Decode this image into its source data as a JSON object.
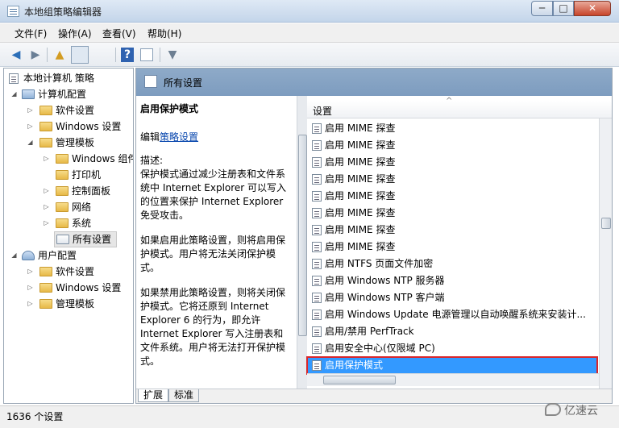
{
  "window": {
    "title": "本地组策略编辑器",
    "min_glyph": "─",
    "max_glyph": "□",
    "close_glyph": "✕"
  },
  "menu": [
    {
      "label": "文件(F)"
    },
    {
      "label": "操作(A)"
    },
    {
      "label": "查看(V)"
    },
    {
      "label": "帮助(H)"
    }
  ],
  "toolbar": {
    "back_glyph": "◀",
    "forward_glyph": "▶",
    "up_glyph": "▲",
    "help_glyph": "?",
    "filter_glyph": "▼"
  },
  "tree": {
    "root": "本地计算机 策略",
    "computer_config": "计算机配置",
    "software_settings": "软件设置",
    "windows_settings": "Windows 设置",
    "admin_templates": "管理模板",
    "windows_components": "Windows 组件",
    "printers": "打印机",
    "control_panel": "控制面板",
    "network": "网络",
    "system": "系统",
    "all_settings": "所有设置",
    "user_config": "用户配置",
    "u_software_settings": "软件设置",
    "u_windows_settings": "Windows 设置",
    "u_admin_templates": "管理模板"
  },
  "right_header": {
    "title": "所有设置"
  },
  "description": {
    "policy_title": "启用保护模式",
    "edit_prefix": "编辑",
    "edit_link": "策略设置",
    "desc_label": "描述:",
    "p1": "保护模式通过减少注册表和文件系统中 Internet Explorer 可以写入的位置来保护 Internet Explorer 免受攻击。",
    "p2": "如果启用此策略设置，则将启用保护模式。用户将无法关闭保护模式。",
    "p3": "如果禁用此策略设置，则将关闭保护模式。它将还原到 Internet Explorer 6 的行为，即允许 Internet Explorer 写入注册表和文件系统。用户将无法打开保护模式。"
  },
  "list": {
    "column": "设置",
    "sort_glyph": "^",
    "rows": [
      "启用 MIME 探查",
      "启用 MIME 探查",
      "启用 MIME 探查",
      "启用 MIME 探查",
      "启用 MIME 探查",
      "启用 MIME 探查",
      "启用 MIME 探查",
      "启用 MIME 探查",
      "启用 NTFS 页面文件加密",
      "启用 Windows NTP 服务器",
      "启用 Windows NTP 客户端",
      "启用 Windows Update 电源管理以自动唤醒系统来安装计...",
      "启用/禁用 PerfTrack",
      "启用安全中心(仅限域 PC)",
      "启用保护模式"
    ],
    "selected_index": 14
  },
  "tabs": {
    "extended": "扩展",
    "standard": "标准"
  },
  "status": {
    "count": "1636 个设置"
  },
  "watermark": {
    "text": "亿速云"
  }
}
